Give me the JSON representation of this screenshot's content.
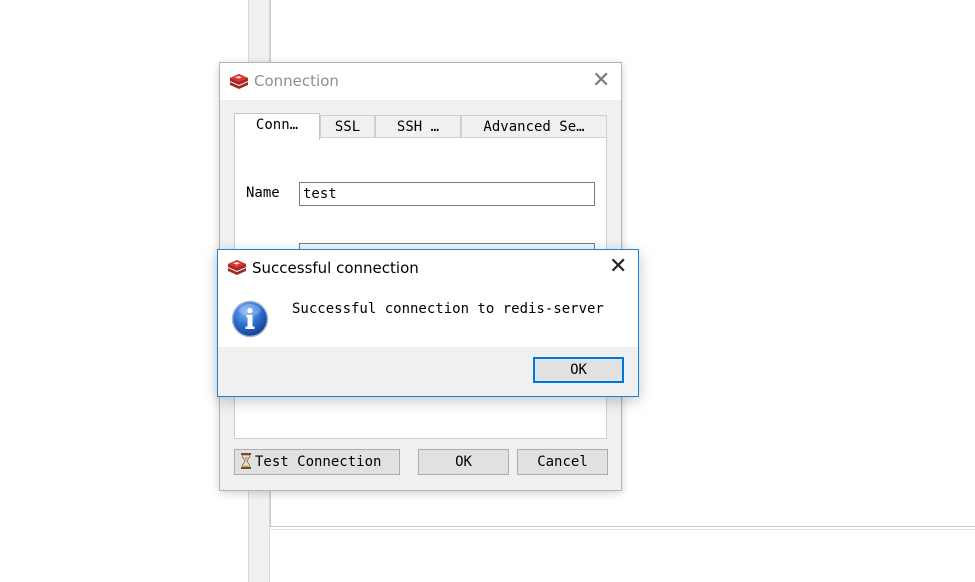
{
  "connection_window": {
    "title": "Connection",
    "close_glyph": "✕",
    "tabs": [
      {
        "label": "Conn…",
        "active": true
      },
      {
        "label": "SSL",
        "active": false
      },
      {
        "label": "SSH …",
        "active": false
      },
      {
        "label": "Advanced Se…",
        "active": false
      }
    ],
    "name_label": "Name",
    "name_value": "test",
    "buttons": {
      "test_connection": "Test Connection",
      "ok": "OK",
      "cancel": "Cancel"
    }
  },
  "success_dialog": {
    "title": "Successful connection",
    "close_glyph": "✕",
    "message": "Successful connection to redis-server",
    "ok_button": "OK",
    "icon": "info-icon"
  },
  "colors": {
    "accent": "#0078d7",
    "dialog_border": "#1883d7",
    "redis_red": "#c9302c",
    "window_bg": "#f0f0f0"
  }
}
